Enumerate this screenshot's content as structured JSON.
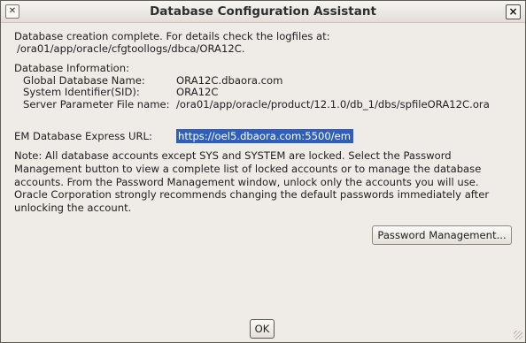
{
  "window": {
    "title": "Database Configuration Assistant",
    "close_glyph": "×",
    "menu_glyph": "✕"
  },
  "status": {
    "line1": "Database creation complete. For details check the logfiles at:",
    "line2": "/ora01/app/oracle/cfgtoollogs/dbca/ORA12C."
  },
  "info": {
    "heading": "Database Information:",
    "rows": [
      {
        "label": "Global Database Name:",
        "value": "ORA12C.dbaora.com"
      },
      {
        "label": "System Identifier(SID):",
        "value": "ORA12C"
      },
      {
        "label": "Server Parameter File name:",
        "value": "/ora01/app/oracle/product/12.1.0/db_1/dbs/spfileORA12C.ora"
      }
    ]
  },
  "em": {
    "label": "EM Database Express URL:",
    "url": "https://oel5.dbaora.com:5500/em"
  },
  "note": "Note: All database accounts except SYS and SYSTEM are locked. Select the Password Management button to view a complete list of locked accounts or to manage the database accounts. From the Password Management window, unlock only the accounts you will use. Oracle Corporation strongly recommends changing the default passwords immediately after unlocking the account.",
  "buttons": {
    "password_management": "Password Management...",
    "ok": "OK"
  }
}
